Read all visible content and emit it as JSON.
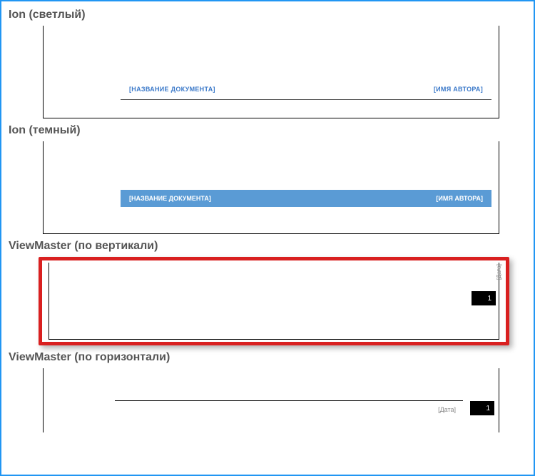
{
  "templates": {
    "ion_light": {
      "label": "Ion (светлый)",
      "doc_placeholder": "[НАЗВАНИЕ ДОКУМЕНТА]",
      "author_placeholder": "[ИМЯ АВТОРА]"
    },
    "ion_dark": {
      "label": "Ion (темный)",
      "doc_placeholder": "[НАЗВАНИЕ ДОКУМЕНТА]",
      "author_placeholder": "[ИМЯ АВТОРА]"
    },
    "vm_vertical": {
      "label": "ViewMaster (по вертикали)",
      "date_placeholder": "[Дата]",
      "page_number": "1"
    },
    "vm_horizontal": {
      "label": "ViewMaster (по горизонтали)",
      "date_placeholder": "[Дата]",
      "page_number": "1"
    }
  },
  "selected_template": "vm_vertical"
}
